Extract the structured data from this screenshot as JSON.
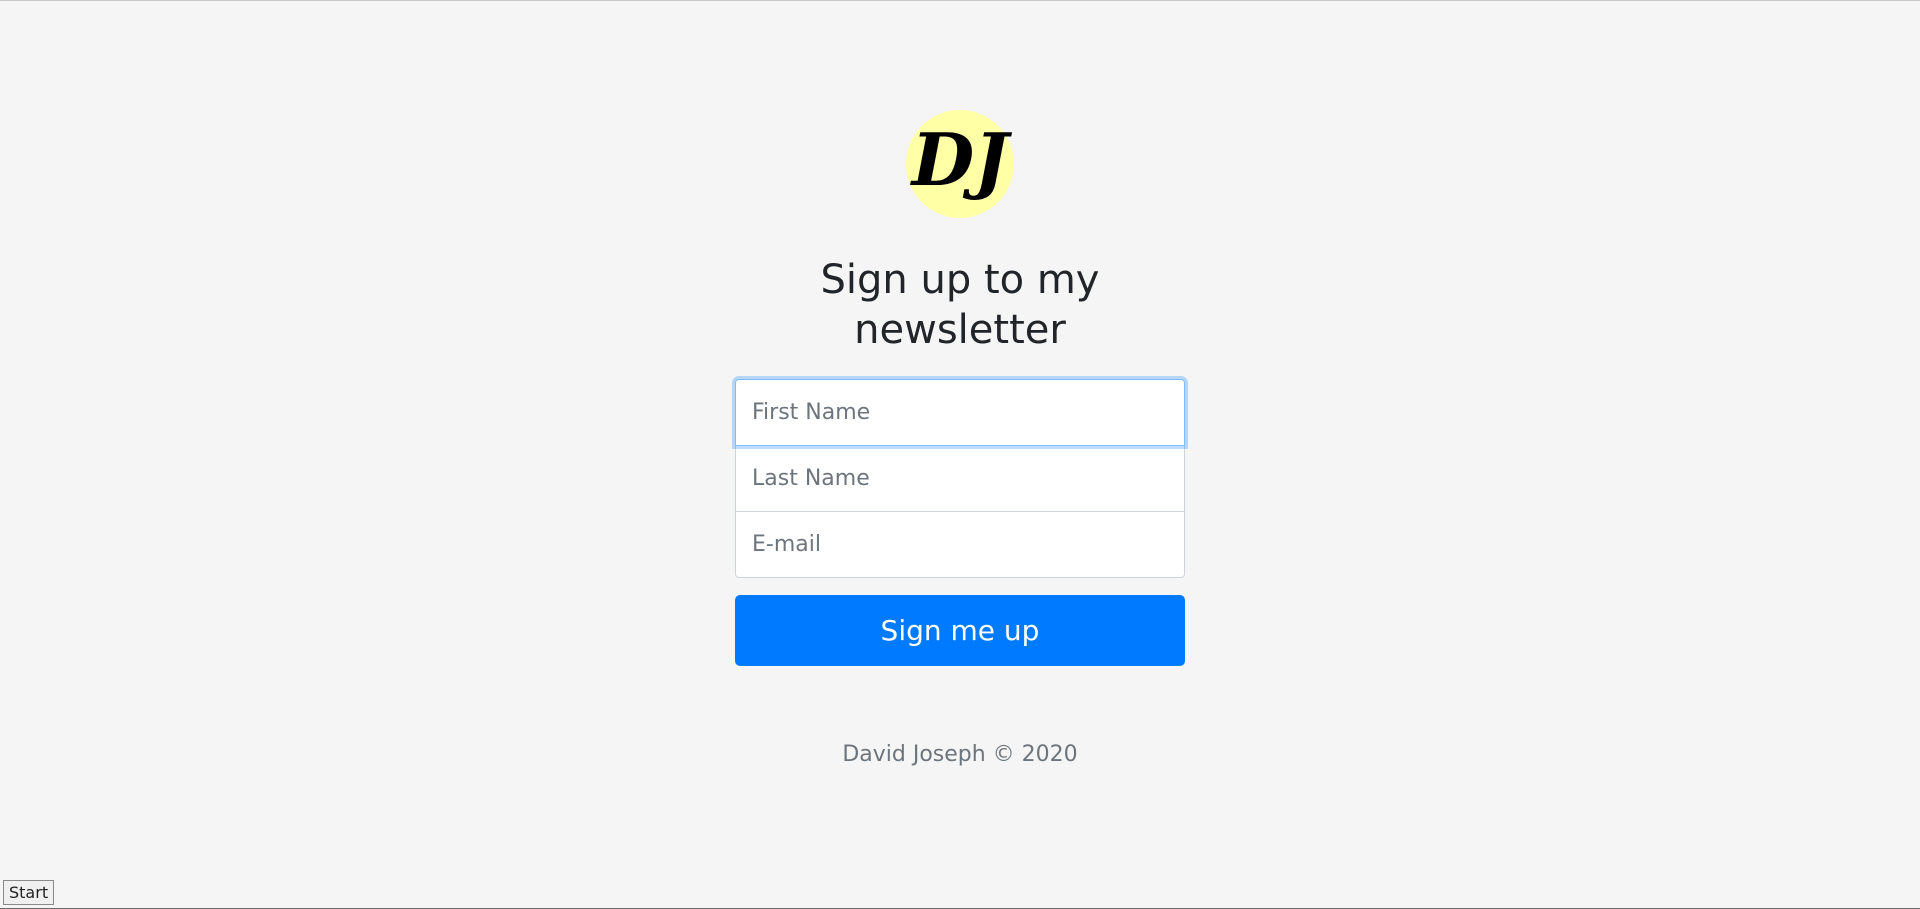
{
  "logo": {
    "text": "DJ",
    "circle_color": "#ffffa6",
    "text_color": "#000000"
  },
  "heading": {
    "line1": "Sign up to my",
    "line2": "newsletter"
  },
  "form": {
    "first_name": {
      "value": "",
      "placeholder": "First Name"
    },
    "last_name": {
      "value": "",
      "placeholder": "Last Name"
    },
    "email": {
      "value": "",
      "placeholder": "E-mail"
    },
    "submit_label": "Sign me up"
  },
  "footer": {
    "text": "David Joseph © 2020"
  },
  "taskbar": {
    "start_label": "Start"
  },
  "colors": {
    "background": "#f5f5f5",
    "accent": "#007bff",
    "focus_ring": "#80bdff"
  }
}
